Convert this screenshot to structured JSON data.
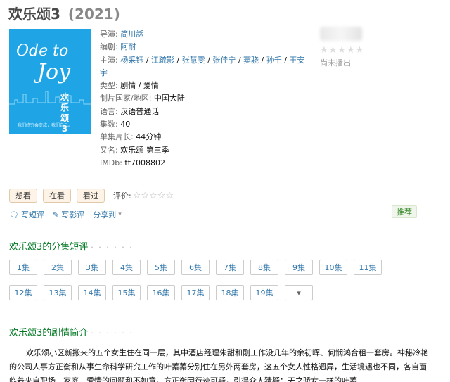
{
  "title": {
    "name": "欢乐颂3",
    "year": "(2021)"
  },
  "poster": {
    "line1": "Ode to",
    "line2": "Joy",
    "cn": "欢乐颂3",
    "tagline": "我们终究会变成，我们自己。"
  },
  "info": {
    "director_label": "导演:",
    "director": "简川訸",
    "writer_label": "编剧:",
    "writer": "阿耐",
    "cast_label": "主演:",
    "cast": [
      "杨采钰",
      "江疏影",
      "张慧雯",
      "张佳宁",
      "窦骁",
      "孙千",
      "王安宇"
    ],
    "genre_label": "类型:",
    "genre": "剧情 / 爱情",
    "country_label": "制片国家/地区:",
    "country": "中国大陆",
    "language_label": "语言:",
    "language": "汉语普通话",
    "episodes_label": "集数:",
    "episodes": "40",
    "runtime_label": "单集片长:",
    "runtime": "44分钟",
    "aka_label": "又名:",
    "aka": "欢乐颂 第三季",
    "imdb_label": "IMDb:",
    "imdb": "tt7008802"
  },
  "rating": {
    "stars": "★★★★★",
    "status": "尚未播出"
  },
  "actions": {
    "want": "想看",
    "watching": "在看",
    "watched": "看过",
    "rate_label": "评价:",
    "rate_stars": "☆☆☆☆☆"
  },
  "subactions": {
    "review": "写短评",
    "long_review": "写影评",
    "share": "分享到",
    "recommend": "推荐"
  },
  "episodes_section": {
    "heading": "欢乐颂3的分集短评",
    "dots": "· · · · · ·",
    "items": [
      "1集",
      "2集",
      "3集",
      "4集",
      "5集",
      "6集",
      "7集",
      "8集",
      "9集",
      "10集",
      "11集",
      "12集",
      "13集",
      "14集",
      "15集",
      "16集",
      "17集",
      "18集",
      "19集"
    ],
    "more": "▾"
  },
  "synopsis_section": {
    "heading": "欢乐颂3的剧情简介",
    "dots": "· · · · · ·",
    "text": "欢乐颂小区新搬来的五个女生住在同一层，其中酒店经理朱甜和刚工作没几年的余初晖、何悯鸿合租一套房。神秘冷艳的公司人事方正衡和从事生命科学研究工作的叶蓁蓁分别住在另外两套房，这五个女人性格迥异，生活境遇也不同，各自面临着来自职场、家庭、爱情的问题和不如意。方正衡因行迹可疑，引得众人猜疑；天之骄女一样的叶蓁"
  },
  "colors": {
    "link": "#3377aa",
    "green": "#007722",
    "poster": "#1fa5e6"
  }
}
